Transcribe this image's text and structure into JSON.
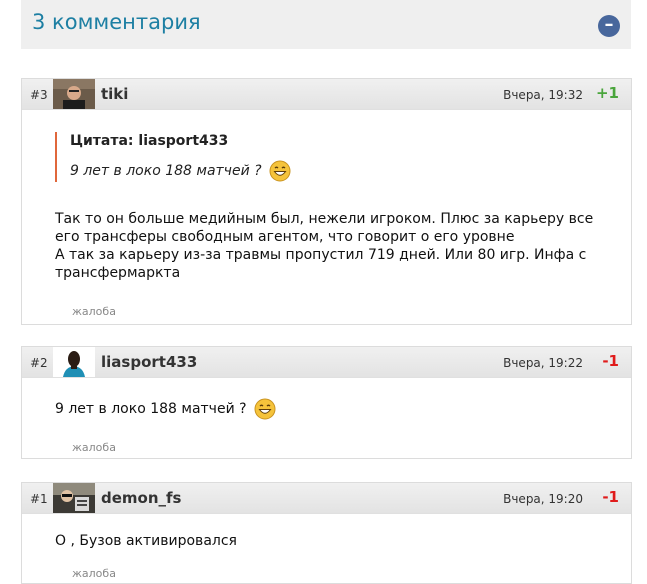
{
  "header": {
    "title": "3 комментария",
    "collapse_label": "–"
  },
  "comments": [
    {
      "num": "#3",
      "author": "tiki",
      "date": "Вчера, 19:32",
      "rating": "+1",
      "quote_title": "Цитата: liasport433",
      "quote_text": "9 лет в локо 188 матчей ?",
      "text_lines": [
        "Так то он больше медийным был, нежели игроком. Плюс за карьеру все",
        "его трансферы свободным агентом, что говорит о его уровне",
        "А так за карьеру из-за травмы пропустил 719 дней. Или 80 игр. Инфа с",
        "трансфермаркта"
      ],
      "report": "жалоба"
    },
    {
      "num": "#2",
      "author": "liasport433",
      "date": "Вчера, 19:22",
      "rating": "-1",
      "text": "9 лет в локо 188 матчей ?",
      "report": "жалоба"
    },
    {
      "num": "#1",
      "author": "demon_fs",
      "date": "Вчера, 19:20",
      "rating": "-1",
      "text": "О , Бузов активировался",
      "report": "жалоба"
    }
  ],
  "colors": {
    "title": "#1d7fa3",
    "collapse_bg": "#48679c",
    "positive": "#4aa53c",
    "negative": "#e01b1b",
    "quote_border": "#e0673b"
  },
  "icons": {
    "smile": "laughing-smiley-icon",
    "collapse": "minus-icon"
  }
}
